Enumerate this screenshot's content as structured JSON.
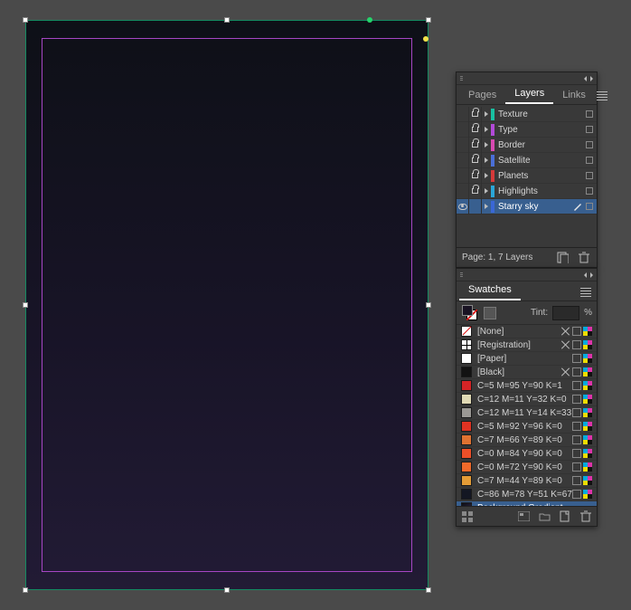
{
  "layersPanel": {
    "tabs": {
      "pages": "Pages",
      "layers": "Layers",
      "links": "Links",
      "active": "layers"
    },
    "layers": [
      {
        "name": "Texture",
        "color": "#19c0a2",
        "locked": true,
        "visible": false,
        "selected": false,
        "pen": false
      },
      {
        "name": "Type",
        "color": "#b24ad8",
        "locked": true,
        "visible": false,
        "selected": false,
        "pen": false
      },
      {
        "name": "Border",
        "color": "#d84ab2",
        "locked": true,
        "visible": false,
        "selected": false,
        "pen": false
      },
      {
        "name": "Satellite",
        "color": "#4a6fd8",
        "locked": true,
        "visible": false,
        "selected": false,
        "pen": false
      },
      {
        "name": "Planets",
        "color": "#d63a3a",
        "locked": true,
        "visible": false,
        "selected": false,
        "pen": false
      },
      {
        "name": "Highlights",
        "color": "#2aa6d8",
        "locked": true,
        "visible": false,
        "selected": false,
        "pen": false
      },
      {
        "name": "Starry sky",
        "color": "#3a67d6",
        "locked": false,
        "visible": true,
        "selected": true,
        "pen": true
      }
    ],
    "footerStatus": "Page: 1, 7 Layers"
  },
  "swatchesPanel": {
    "title": "Swatches",
    "tintLabel": "Tint:",
    "tintValue": "",
    "tintSuffix": "%",
    "swatches": [
      {
        "name": "[None]",
        "kind": "none",
        "color": "#ffffff",
        "selected": false,
        "lockable": true
      },
      {
        "name": "[Registration]",
        "kind": "reg",
        "color": "#ffffff",
        "selected": false,
        "lockable": true
      },
      {
        "name": "[Paper]",
        "kind": "plain",
        "color": "#ffffff",
        "selected": false
      },
      {
        "name": "[Black]",
        "kind": "process",
        "color": "#131313",
        "selected": false,
        "lockable": true
      },
      {
        "name": "C=5 M=95 Y=90 K=1",
        "kind": "process",
        "color": "#d42426",
        "selected": false
      },
      {
        "name": "C=12 M=11 Y=32 K=0",
        "kind": "process",
        "color": "#e0d9b4",
        "selected": false
      },
      {
        "name": "C=12 M=11 Y=14 K=33",
        "kind": "process",
        "color": "#9a9894",
        "selected": false
      },
      {
        "name": "C=5 M=92 Y=96 K=0",
        "kind": "process",
        "color": "#e03322",
        "selected": false
      },
      {
        "name": "C=7 M=66 Y=89 K=0",
        "kind": "process",
        "color": "#e07231",
        "selected": false
      },
      {
        "name": "C=0 M=84 Y=90 K=0",
        "kind": "process",
        "color": "#ee4f28",
        "selected": false
      },
      {
        "name": "C=0 M=72 Y=90 K=0",
        "kind": "process",
        "color": "#f06a2a",
        "selected": false
      },
      {
        "name": "C=7 M=44 Y=89 K=0",
        "kind": "process",
        "color": "#e49c36",
        "selected": false
      },
      {
        "name": "C=86 M=78 Y=51 K=67",
        "kind": "process",
        "color": "#141723",
        "selected": false
      },
      {
        "name": "Background Gradient",
        "kind": "gradient",
        "color": "#151021",
        "selected": true
      }
    ]
  }
}
